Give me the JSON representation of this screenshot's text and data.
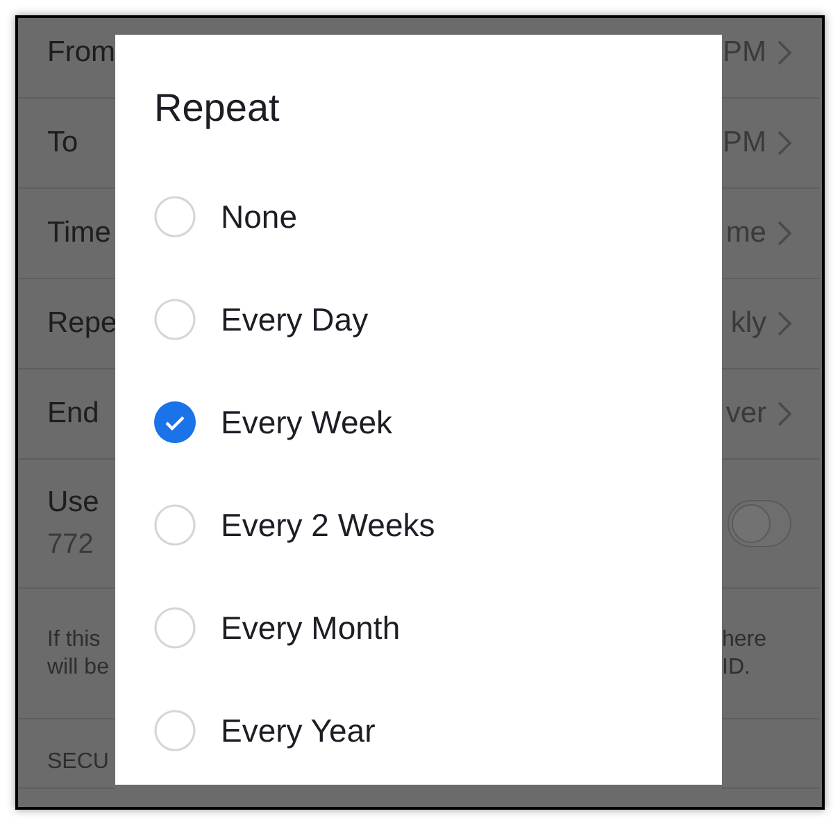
{
  "settings_rows": [
    {
      "kind": "link",
      "label": "From",
      "value": "PM"
    },
    {
      "kind": "link",
      "label": "To",
      "value": "PM"
    },
    {
      "kind": "link",
      "label": "Time",
      "value": "me"
    },
    {
      "kind": "link",
      "label": "Repe",
      "value": "kly"
    },
    {
      "kind": "link",
      "label": "End",
      "value": "ver"
    },
    {
      "kind": "toggle",
      "label": "Use",
      "sublabel": "772",
      "on": false
    }
  ],
  "note": {
    "left": [
      "If this",
      "will be"
    ],
    "right": [
      "here",
      "ID."
    ]
  },
  "section_header": "SECU",
  "dialog": {
    "title": "Repeat",
    "options": [
      {
        "label": "None",
        "selected": false
      },
      {
        "label": "Every Day",
        "selected": false
      },
      {
        "label": "Every Week",
        "selected": true
      },
      {
        "label": "Every 2 Weeks",
        "selected": false
      },
      {
        "label": "Every Month",
        "selected": false
      },
      {
        "label": "Every Year",
        "selected": false
      }
    ]
  }
}
